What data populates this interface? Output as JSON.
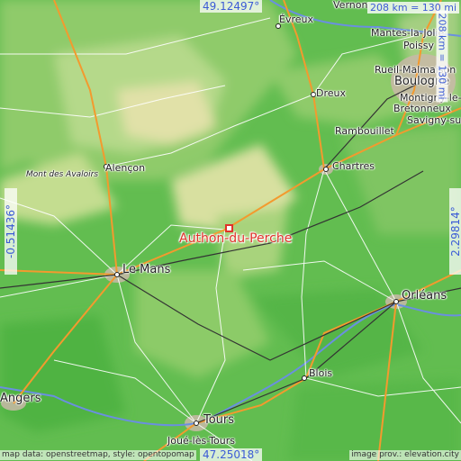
{
  "map": {
    "colors": {
      "lowland": "#5fba4e",
      "midland": "#a9d37a",
      "upland": "#e6e2a6",
      "road_major": "#f39a2e",
      "road_minor": "#ffffff",
      "rail": "#333333",
      "water": "#6a8fe0",
      "accent": "#e0322a",
      "label_blue": "#3c5bd6"
    },
    "target": {
      "name": "Authon-du-Perche",
      "icon": "square-marker-icon"
    },
    "coords": {
      "top": "49.12497°",
      "bottom": "47.25018°",
      "left": "-0.51436°",
      "right": "2.29814°"
    },
    "scale": {
      "horizontal": "208 km = 130 mi",
      "vertical": "208 km = 130 mi"
    },
    "attribution": {
      "left": "map data: openstreetmap, style: opentopomap",
      "right": "image prov.: elevation.city"
    },
    "cities": {
      "vernon": "Vernon",
      "evreux": "Évreux",
      "mantes": "Mantes-la-Jolie",
      "poissy": "Poissy",
      "rueil": "Rueil-Malmaison",
      "boulogne": "Boulogne",
      "montigny": "Montigny-le-",
      "bretonneux": "Bretonneux",
      "savigny": "Savigny-su",
      "dreux": "Dreux",
      "rambouillet": "Rambouillet",
      "chartres": "Chartres",
      "alencon": "Alençon",
      "avaloirs": "Mont des Avaloirs",
      "lemans": "Le Mans",
      "orleans": "Orléans",
      "blois": "Blois",
      "angers": "Angers",
      "tours": "Tours",
      "joue": "Joué-lès-Tours"
    }
  }
}
